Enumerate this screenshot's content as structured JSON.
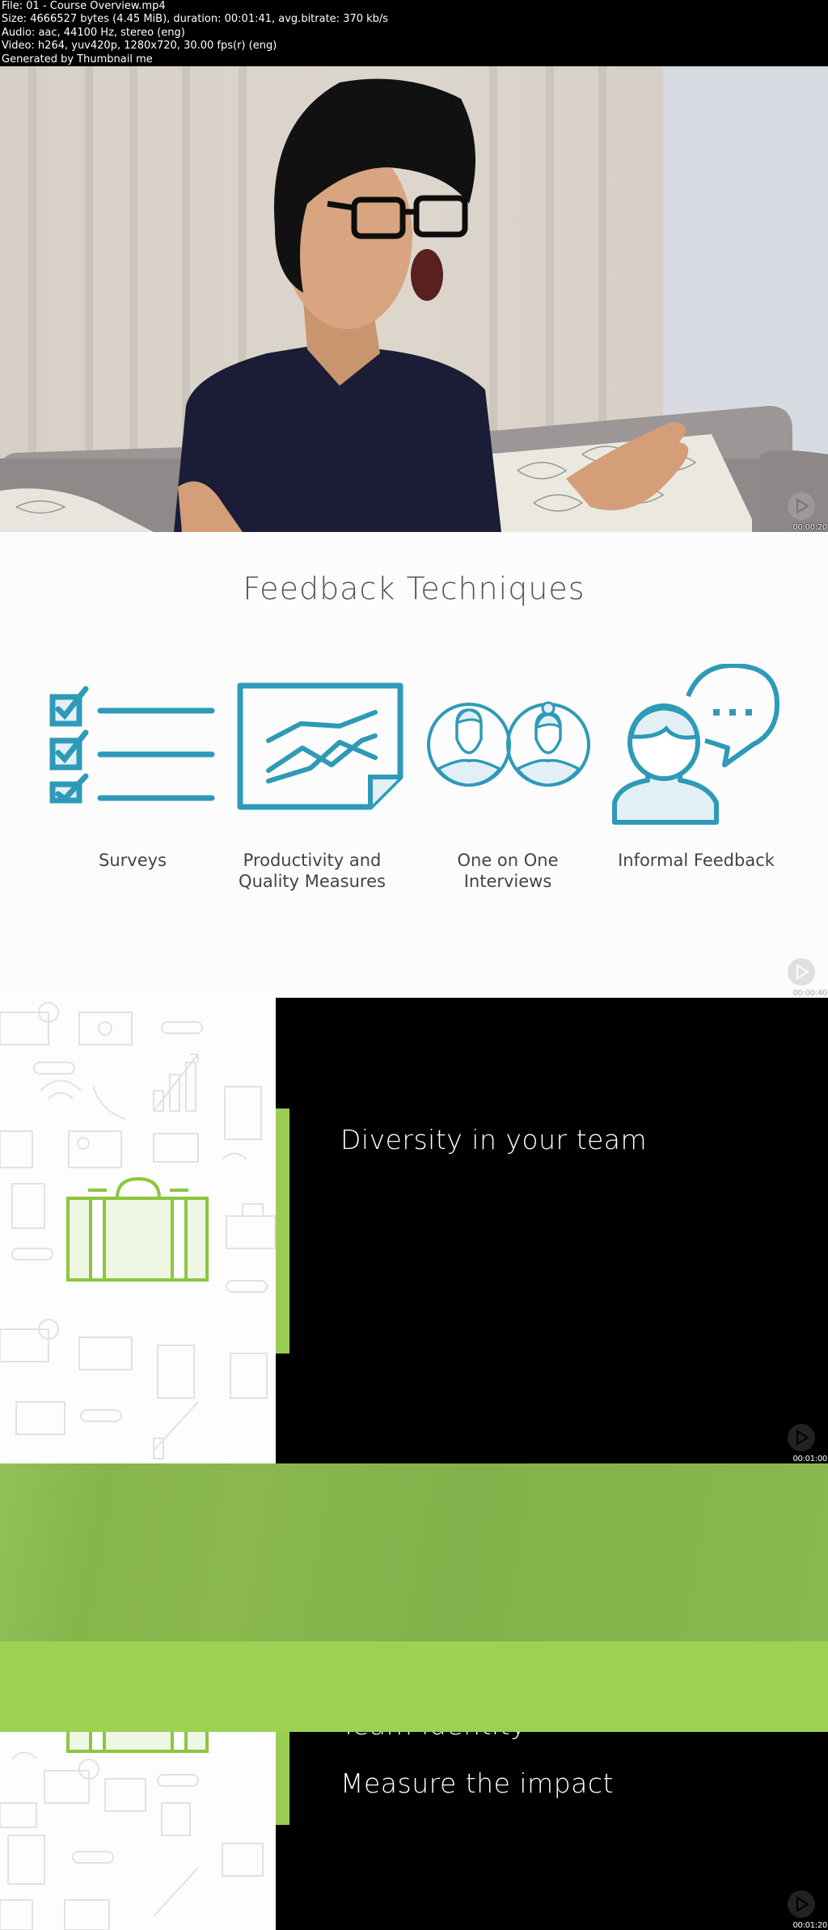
{
  "file_info": {
    "lines": [
      "File: 01 - Course Overview.mp4",
      "Size: 4666527 bytes (4.45 MiB), duration: 00:01:41, avg.bitrate: 370 kb/s",
      "Audio: aac, 44100 Hz, stereo (eng)",
      "Video: h264, yuv420p, 1280x720, 30.00 fps(r) (eng)",
      "Generated by Thumbnail me"
    ]
  },
  "frames": [
    {
      "timestamp": "00:00:20",
      "description": "Man on a sofa shouting with raised hands"
    },
    {
      "timestamp": "00:00:40"
    },
    {
      "timestamp": "00:01:00"
    },
    {
      "timestamp": "00:01:20"
    }
  ],
  "slide_feedback": {
    "title": "Feedback Techniques",
    "accent_color": "#2e9ab8",
    "items": [
      {
        "label": "Surveys",
        "icon": "checklist-icon"
      },
      {
        "label": "Productivity and Quality Measures",
        "icon": "line-chart-icon"
      },
      {
        "label": "One on One Interviews",
        "icon": "two-people-icon"
      },
      {
        "label": "Informal Feedback",
        "icon": "person-speech-icon"
      }
    ]
  },
  "slide_diversity": {
    "accent_color": "#9acd51",
    "icon": "briefcase-icon",
    "bullets": [
      "Diversity in your team"
    ]
  },
  "slide_transition": {
    "accent_color": "#9cd153",
    "bullets": [
      "Team identity",
      "Measure the impact"
    ]
  }
}
